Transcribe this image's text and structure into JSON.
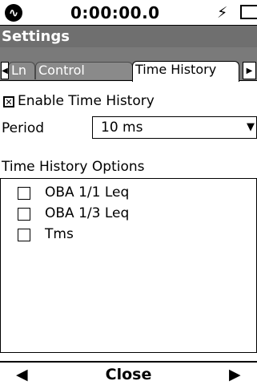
{
  "status_bar": {
    "timer": "0:00:00.0",
    "logo_icon": "sound-wave-logo-icon",
    "power_icon": "power-bolt-icon",
    "battery_icon": "battery-icon"
  },
  "title": "Settings",
  "tabs": [
    {
      "label": "Ln",
      "active": false
    },
    {
      "label": "Control",
      "active": false
    },
    {
      "label": "Time History",
      "active": true
    }
  ],
  "enable_time_history": {
    "label": "Enable Time History",
    "checked": true
  },
  "period": {
    "label": "Period",
    "value": "10 ms"
  },
  "options": {
    "header": "Time History Options",
    "items": [
      {
        "label": "OBA 1/1 Leq",
        "checked": false
      },
      {
        "label": "OBA 1/3 Leq",
        "checked": false
      },
      {
        "label": "Tms",
        "checked": false
      }
    ]
  },
  "bottom": {
    "close_label": "Close"
  }
}
